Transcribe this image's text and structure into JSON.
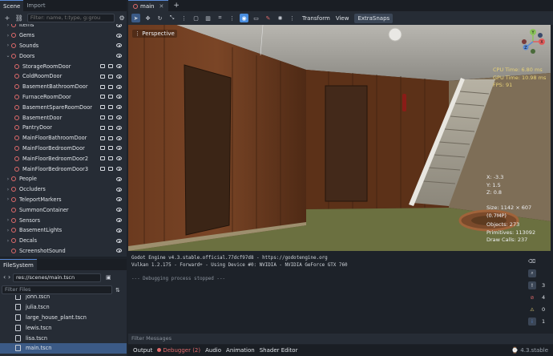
{
  "scene_dock": {
    "tabs": [
      {
        "label": "Scene"
      },
      {
        "label": "Import"
      }
    ],
    "filter_placeholder": "Filter: name, t:type, g:grou",
    "tree": [
      {
        "label": "Items",
        "expanded": false,
        "icons": false
      },
      {
        "label": "Gems",
        "expanded": false,
        "icons": false
      },
      {
        "label": "Sounds",
        "expanded": false,
        "icons": false
      },
      {
        "label": "Doors",
        "expanded": true,
        "icons": false
      },
      {
        "label": "StorageRoomDoor",
        "child": true,
        "icons": true
      },
      {
        "label": "ColdRoomDoor",
        "child": true,
        "icons": true
      },
      {
        "label": "BasementBathroomDoor",
        "child": true,
        "icons": true
      },
      {
        "label": "FurnaceRoomDoor",
        "child": true,
        "icons": true
      },
      {
        "label": "BasementSpareRoomDoor",
        "child": true,
        "icons": true
      },
      {
        "label": "BasementDoor",
        "child": true,
        "icons": true
      },
      {
        "label": "PantryDoor",
        "child": true,
        "icons": true
      },
      {
        "label": "MainFloorBathroomDoor",
        "child": true,
        "icons": true
      },
      {
        "label": "MainFloorBedroomDoor",
        "child": true,
        "icons": true
      },
      {
        "label": "MainFloorBedroomDoor2",
        "child": true,
        "icons": true
      },
      {
        "label": "MainFloorBedroomDoor3",
        "child": true,
        "icons": true
      },
      {
        "label": "People",
        "expanded": false,
        "icons": false
      },
      {
        "label": "Occluders",
        "expanded": false,
        "icons": false
      },
      {
        "label": "TeleportMarkers",
        "expanded": false,
        "icons": false
      },
      {
        "label": "SummonContainer",
        "expanded": null,
        "icons": false
      },
      {
        "label": "Sensors",
        "expanded": false,
        "icons": false
      },
      {
        "label": "BasementLights",
        "expanded": false,
        "icons": false
      },
      {
        "label": "Decals",
        "expanded": false,
        "icons": false
      },
      {
        "label": "ScreenshotSound",
        "expanded": null,
        "icons": false
      }
    ]
  },
  "filesystem": {
    "tab": "FileSystem",
    "path": "res://scenes/main.tscn",
    "filter_placeholder": "Filter Files",
    "files": [
      "john.tscn",
      "julia.tscn",
      "large_house_plant.tscn",
      "lewis.tscn",
      "lisa.tscn",
      "main.tscn"
    ],
    "selected": "main.tscn"
  },
  "main_tabs": {
    "scene_tab": "main",
    "add": "+"
  },
  "editor_toolbar": {
    "menus": [
      "Transform",
      "View",
      "ExtraSnaps"
    ]
  },
  "viewport": {
    "perspective_label": "Perspective",
    "stats": {
      "cpu": "CPU Time: 6.80 ms",
      "gpu": "GPU Time: 10.98 ms",
      "fps": "FPS: 91"
    },
    "position": {
      "x": "X: -3.3",
      "y": "Y: 1.5",
      "z": "Z: 0.8"
    },
    "size": "Size: 1142 × 607 (0.7MP)",
    "counters": {
      "objects": "Objects: 273",
      "primitives": "Primitives: 113092",
      "drawcalls": "Draw Calls: 237"
    },
    "gizmo": {
      "y": "Y",
      "x": "X",
      "z": "Z"
    }
  },
  "debugger": {
    "lines": [
      "Godot Engine v4.3.stable.official.77dcf97d8 - https://godotengine.org",
      "Vulkan 1.2.175 - Forward+ - Using Device #0: NVIDIA - NVIDIA GeForce GTX 760",
      "",
      "--- Debugging process stopped ---"
    ],
    "badges": [
      {
        "count": "3",
        "color": "#9aa3ad"
      },
      {
        "count": "4",
        "color": "#e06b6b"
      },
      {
        "count": "0",
        "color": "#e8d277"
      },
      {
        "count": "1",
        "color": "#5a8ad6"
      }
    ],
    "filter_placeholder": "Filter Messages"
  },
  "bottom_bar": {
    "tabs": [
      "Output",
      "Debugger (2)",
      "Audio",
      "Animation",
      "Shader Editor"
    ],
    "version": "4.3.stable"
  }
}
